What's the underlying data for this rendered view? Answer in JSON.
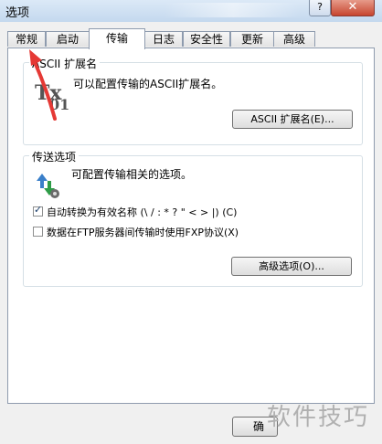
{
  "window": {
    "title": "选项",
    "help_label": "?",
    "close_label": "✕"
  },
  "tabs": [
    {
      "label": "常规"
    },
    {
      "label": "启动"
    },
    {
      "label": "传输"
    },
    {
      "label": "日志"
    },
    {
      "label": "安全性"
    },
    {
      "label": "更新"
    },
    {
      "label": "高级"
    }
  ],
  "ascii_group": {
    "title": "ASCII 扩展名",
    "description": "可以配置传输的ASCII扩展名。",
    "button_label": "ASCII 扩展名(E)...",
    "icon_text_1": "Tx",
    "icon_text_2": "01"
  },
  "transfer_group": {
    "title": "传送选项",
    "description": "可配置传输相关的选项。",
    "auto_convert_label": "自动转换为有效名称 (\\ / : * ? \" < > |) (C)",
    "auto_convert_checked": true,
    "fxp_label": "数据在FTP服务器间传输时使用FXP协议(X)",
    "fxp_checked": false,
    "advanced_button_label": "高级选项(O)..."
  },
  "footer": {
    "ok_label": "确"
  },
  "watermark": "软件技巧",
  "annotation_color": "#e53935"
}
